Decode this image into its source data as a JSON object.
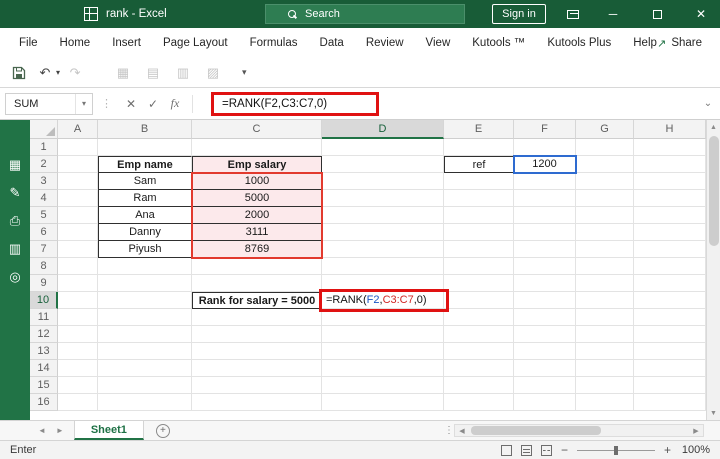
{
  "titlebar": {
    "title": "rank  -  Excel",
    "search_label": "Search",
    "signin_label": "Sign in"
  },
  "ribbon": {
    "tabs": [
      "File",
      "Home",
      "Insert",
      "Page Layout",
      "Formulas",
      "Data",
      "Review",
      "View",
      "Kutools ™",
      "Kutools Plus",
      "Help"
    ],
    "share_label": "Share"
  },
  "formula_bar": {
    "name_box": "SUM",
    "formula": "=RANK(F2,C3:C7,0)"
  },
  "sheet": {
    "col_headers": [
      "A",
      "B",
      "C",
      "D",
      "E",
      "F",
      "G",
      "H"
    ],
    "row_count": 16,
    "selected_column": "D",
    "selected_row": 10,
    "emp_table": {
      "headers": [
        "Emp name",
        "Emp salary"
      ],
      "rows": [
        [
          "Sam",
          "1000"
        ],
        [
          "Ram",
          "5000"
        ],
        [
          "Ana",
          "2000"
        ],
        [
          "Danny",
          "3111"
        ],
        [
          "Piyush",
          "8769"
        ]
      ]
    },
    "ref_label": "ref",
    "ref_value": "1200",
    "rank_label": "Rank for salary = 5000",
    "rank_formula_parts": [
      {
        "text": "=RANK(",
        "color": "#111111"
      },
      {
        "text": "F2",
        "color": "#1a56c4"
      },
      {
        "text": ",",
        "color": "#111111"
      },
      {
        "text": "C3:C7",
        "color": "#d02725"
      },
      {
        "text": ",0)",
        "color": "#111111"
      }
    ]
  },
  "sidebar_icons": [
    "calendar-icon",
    "edit-icon",
    "printer-icon",
    "grid-icon",
    "view-icon"
  ],
  "sheet_tabs": {
    "active": "Sheet1"
  },
  "status_bar": {
    "mode": "Enter",
    "zoom": "100%"
  },
  "colors": {
    "accent_green": "#217346",
    "annotation_red": "#e01212",
    "ref_blue": "#2e6bd0",
    "ref_red": "#e23a2e",
    "pink_fill": "#fce9eb"
  }
}
